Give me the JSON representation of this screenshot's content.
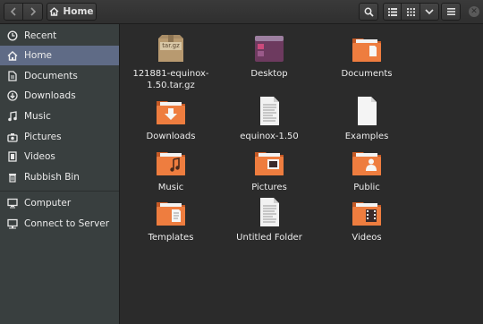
{
  "header": {
    "back_icon": "chevron-left-icon",
    "forward_icon": "chevron-right-icon",
    "path_label": "Home",
    "view_icons": [
      "list-view-icon",
      "grid-view-icon",
      "chevron-down-icon"
    ],
    "close_glyph": "✕"
  },
  "sidebar": {
    "items": [
      {
        "label": "Recent",
        "icon": "clock-icon"
      },
      {
        "label": "Home",
        "icon": "home-icon",
        "active": true
      },
      {
        "label": "Documents",
        "icon": "document-icon"
      },
      {
        "label": "Downloads",
        "icon": "download-icon"
      },
      {
        "label": "Music",
        "icon": "music-icon"
      },
      {
        "label": "Pictures",
        "icon": "camera-icon"
      },
      {
        "label": "Videos",
        "icon": "film-icon"
      },
      {
        "label": "Rubbish Bin",
        "icon": "trash-icon"
      },
      {
        "label": "Computer",
        "icon": "computer-icon"
      },
      {
        "label": "Connect to Server",
        "icon": "server-icon"
      }
    ]
  },
  "files": [
    {
      "name": "121881-equinox-1.50.tar.gz",
      "line1": "121881-equinox-",
      "line2": "1.50.tar.gz",
      "icon": "archive-icon",
      "archive_text": "tar.gz"
    },
    {
      "name": "Desktop",
      "line1": "Desktop",
      "icon": "desktop-folder-icon"
    },
    {
      "name": "Documents",
      "line1": "Documents",
      "icon": "documents-folder-icon"
    },
    {
      "name": "Downloads",
      "line1": "Downloads",
      "icon": "downloads-folder-icon"
    },
    {
      "name": "equinox-1.50",
      "line1": "equinox-1.50",
      "icon": "text-file-icon"
    },
    {
      "name": "Examples",
      "line1": "Examples",
      "icon": "blank-file-icon"
    },
    {
      "name": "Music",
      "line1": "Music",
      "icon": "music-folder-icon"
    },
    {
      "name": "Pictures",
      "line1": "Pictures",
      "icon": "pictures-folder-icon"
    },
    {
      "name": "Public",
      "line1": "Public",
      "icon": "public-folder-icon"
    },
    {
      "name": "Templates",
      "line1": "Templates",
      "icon": "templates-folder-icon"
    },
    {
      "name": "Untitled Folder",
      "line1": "Untitled Folder",
      "icon": "text-file-icon"
    },
    {
      "name": "Videos",
      "line1": "Videos",
      "icon": "videos-folder-icon"
    }
  ],
  "colors": {
    "accent": "#5f6b86",
    "folder_orange": "#e8743b",
    "sidebar_bg": "#393f3f",
    "main_bg": "#2b2b2b"
  }
}
